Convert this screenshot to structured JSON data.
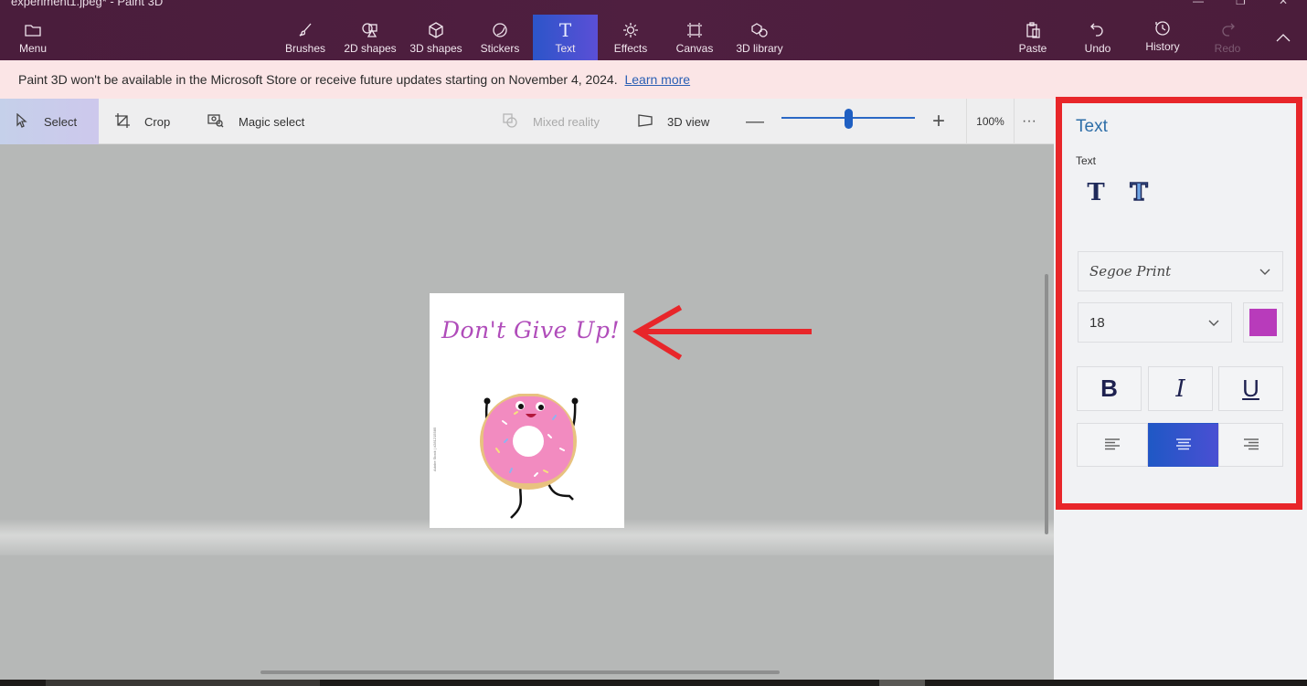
{
  "window": {
    "title": "experiment1.jpeg* - Paint 3D"
  },
  "ribbon": {
    "menu": {
      "label": "Menu",
      "icon": "folder-icon"
    },
    "tools": [
      {
        "label": "Brushes",
        "icon": "brush-icon",
        "active": false
      },
      {
        "label": "2D shapes",
        "icon": "2d-shapes-icon",
        "active": false
      },
      {
        "label": "3D shapes",
        "icon": "3d-cube-icon",
        "active": false
      },
      {
        "label": "Stickers",
        "icon": "sticker-icon",
        "active": false
      },
      {
        "label": "Text",
        "icon": "text-icon",
        "active": true
      },
      {
        "label": "Effects",
        "icon": "sun-icon",
        "active": false
      },
      {
        "label": "Canvas",
        "icon": "canvas-icon",
        "active": false
      },
      {
        "label": "3D library",
        "icon": "3d-library-icon",
        "active": false
      }
    ],
    "actions": [
      {
        "label": "Paste",
        "icon": "paste-icon",
        "enabled": true
      },
      {
        "label": "Undo",
        "icon": "undo-icon",
        "enabled": true
      },
      {
        "label": "History",
        "icon": "history-icon",
        "enabled": true
      },
      {
        "label": "Redo",
        "icon": "redo-icon",
        "enabled": false
      }
    ],
    "collapse_icon": "chevron-up-icon"
  },
  "notice": {
    "message": "Paint 3D won't be available in the Microsoft Store or receive future updates starting on November 4, 2024.",
    "link": "Learn more"
  },
  "toolbar": {
    "select": "Select",
    "crop": "Crop",
    "magic_select": "Magic select",
    "mixed_reality": "Mixed reality",
    "view_3d": "3D view",
    "zoom_percent": "100%",
    "zoom_level_fraction": 0.5,
    "more": "···"
  },
  "canvas": {
    "text_content": "Don't Give Up!",
    "text_color": "#b04cba",
    "image_subject": "dancing pink donut character",
    "watermark": "Adobe Stock | #281215585"
  },
  "panel": {
    "title": "Text",
    "section_label": "Text",
    "text_styles": [
      "2D text",
      "3D text"
    ],
    "font": "Segoe Print",
    "size": "18",
    "color": "#b83bbb",
    "format": {
      "bold": "B",
      "italic": "I",
      "underline": "U"
    },
    "alignment": [
      "left",
      "center",
      "right"
    ],
    "active_alignment": "center"
  },
  "colors": {
    "ribbon_bg": "#4d1e3f",
    "accent_blue": "#2c55c9",
    "highlight_frame": "#e8262a"
  }
}
